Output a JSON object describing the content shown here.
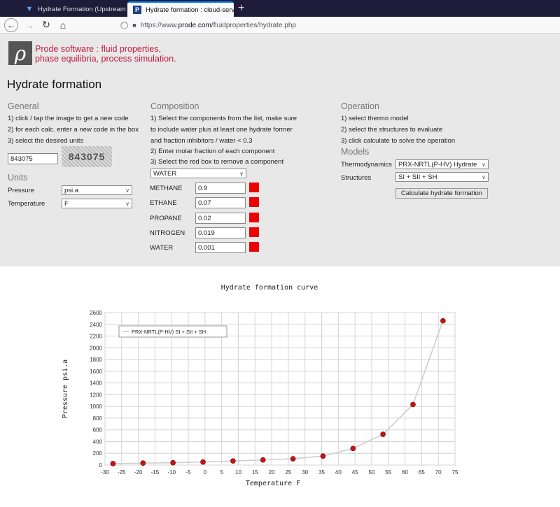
{
  "browser": {
    "tabs": [
      {
        "title": "Hydrate Formation (Upstream"
      },
      {
        "title": "Hydrate formation : cloud-serv"
      }
    ],
    "url_prefix": "https://www.",
    "url_host": "prode.com",
    "url_path": "/fluidproperties/hydrate.php"
  },
  "header": {
    "logo_glyph": "ρ",
    "tagline_line1": "Prode software : fluid properties,",
    "tagline_line2": "phase equilibria, process simulation.",
    "title": "Hydrate formation"
  },
  "general": {
    "heading": "General",
    "lines": [
      "1) click / tap the image to get a new code",
      "2) for each calc. enter a new code in the box",
      "3) select the desired units"
    ],
    "code_value": "843075",
    "captcha_text": "843075"
  },
  "units": {
    "heading": "Units",
    "pressure_label": "Pressure",
    "pressure_value": "psi.a",
    "temperature_label": "Temperature",
    "temperature_value": "F"
  },
  "composition": {
    "heading": "Composition",
    "lines": [
      "1) Select the components from the list, make sure",
      "to include water plus at least one hydrate former",
      "and fraction inhibitors / water < 0.3",
      "2) Enter molar fraction of each component",
      "3) Select the red box to remove a component"
    ],
    "component_select": "WATER",
    "components": [
      {
        "name": "METHANE",
        "value": "0.9"
      },
      {
        "name": "ETHANE",
        "value": "0.07"
      },
      {
        "name": "PROPANE",
        "value": "0.02"
      },
      {
        "name": "NITROGEN",
        "value": "0.019"
      },
      {
        "name": "WATER",
        "value": "0.001"
      }
    ],
    "remove_color": "#ee0000"
  },
  "operation": {
    "heading": "Operation",
    "lines": [
      "1) select thermo model",
      "2) select the structures to evaluate",
      "3) click calculate to solve the operation"
    ]
  },
  "models": {
    "heading": "Models",
    "thermo_label": "Thermodynamics",
    "thermo_value": "PRX-NRTL(P-HV) Hydrate",
    "structures_label": "Structures",
    "structures_value": "SI + SII + SH",
    "calculate_label": "Calculate hydrate formation"
  },
  "chart_data": {
    "type": "line",
    "title": "Hydrate formation curve",
    "xlabel": "Temperature F",
    "ylabel": "Pressure psi.a",
    "xlim": [
      -30,
      75
    ],
    "ylim": [
      0,
      2600
    ],
    "xticks": [
      -30,
      -25,
      -20,
      -15,
      -10,
      -5,
      0,
      5,
      10,
      15,
      20,
      25,
      30,
      35,
      40,
      45,
      50,
      55,
      60,
      65,
      70,
      75
    ],
    "yticks": [
      0,
      200,
      400,
      600,
      800,
      1000,
      1200,
      1400,
      1600,
      1800,
      2000,
      2200,
      2400,
      2600
    ],
    "grid": true,
    "legend": "top-left",
    "series": [
      {
        "name": "PRX-NRTL(P-HV) SI + SII + SH",
        "line_color": "#cccccc",
        "marker_color": "#cc1111",
        "x": [
          -27.6,
          -18.6,
          -9.6,
          -0.6,
          8.4,
          17.4,
          26.4,
          35.4,
          44.4,
          53.4,
          62.4,
          71.4
        ],
        "y": [
          25,
          33,
          40,
          52,
          70,
          87,
          107,
          153,
          283,
          524,
          1033,
          2460
        ]
      }
    ]
  }
}
